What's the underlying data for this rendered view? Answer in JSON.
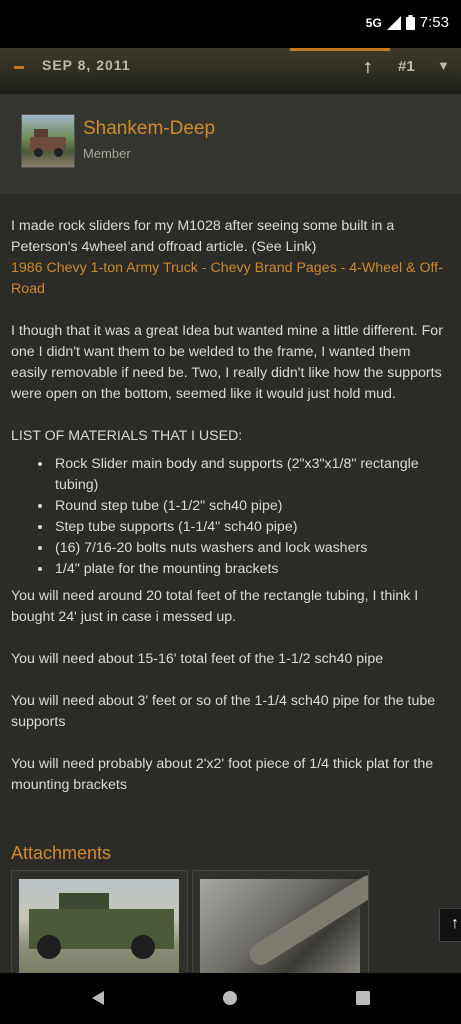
{
  "status_bar": {
    "network": "5G",
    "time": "7:53"
  },
  "post_header": {
    "date": "SEP 8, 2011",
    "post_number": "#1"
  },
  "author": {
    "name": "Shankem-Deep",
    "role": "Member"
  },
  "body": {
    "intro": "I made rock sliders for my M1028 after seeing some built in a Peterson's 4wheel and offroad article. (See Link)",
    "link_text": "1986 Chevy 1-ton Army Truck - Chevy Brand Pages - 4-Wheel & Off-Road",
    "paragraph2": "I though that it was a great Idea but wanted mine a little different. For one I didn't want them to be welded to the frame, I wanted them easily removable if need be. Two, I really didn't like how the supports were open on the bottom, seemed like it would just hold mud.",
    "materials_heading": "LIST OF MATERIALS THAT I USED:",
    "materials": [
      "Rock Slider main body and supports (2\"x3\"x1/8\" rectangle tubing)",
      "Round step tube (1-1/2\" sch40 pipe)",
      "Step tube supports (1-1/4\" sch40 pipe)",
      "(16) 7/16-20 bolts nuts washers and lock washers",
      "1/4\" plate for the mounting brackets"
    ],
    "note1": "You will need around 20 total feet of the rectangle tubing, I think I bought 24' just in case i messed up.",
    "note2": "You will need about 15-16' total feet of the 1-1/2 sch40 pipe",
    "note3": "You will need about 3' feet or so of the 1-1/4 sch40 pipe for the tube supports",
    "note4": "You will need probably about 2'x2' foot piece of 1/4 thick plat for the mounting brackets"
  },
  "attachments": {
    "title": "Attachments"
  },
  "icons": {
    "share": "share-icon",
    "bookmark": "bookmark-icon",
    "scroll_top": "arrow-up-icon",
    "nav_back": "back-triangle-icon",
    "nav_home": "home-circle-icon",
    "nav_recents": "recents-square-icon"
  },
  "colors": {
    "accent": "#d08a2e",
    "background": "#2b2b27"
  }
}
